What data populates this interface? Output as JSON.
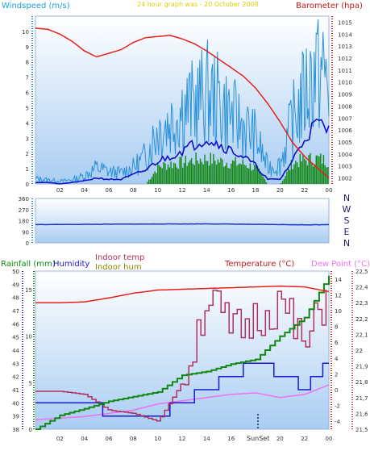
{
  "colors": {
    "plot_bg_top": "#ffffff",
    "plot_bg_bottom": "#a9cdf2",
    "windspeed_title": "#1aa0d8",
    "barometer": "#e8201a",
    "wind_gust": "#2a92d8",
    "wind_avg": "#1010cc",
    "wind_dir_bars": "#118811",
    "direction_line": "#1a2fc8",
    "rainfall": "#118811",
    "humidity": "#1a1acc",
    "indoor_temp": "#b03060",
    "indoor_hum": "#888800",
    "temperature": "#e8201a",
    "dew_point": "#f070f0",
    "axis_left_blue": "#1a7fc0",
    "axis_right_red": "#c01818"
  },
  "top": {
    "title": "24 hour graph was - 20 October 2008",
    "windspeed_label": "Windspeed (m/s)",
    "barometer_label": "Barometer (hpa)",
    "x_ticks": [
      "02",
      "04",
      "06",
      "08",
      "10",
      "12",
      "14",
      "16",
      "18",
      "20",
      "22",
      "00"
    ],
    "left_ticks": [
      "10",
      "9",
      "8",
      "7",
      "6",
      "5",
      "4",
      "3",
      "2",
      "1",
      "0"
    ],
    "right_ticks": [
      "1015",
      "1014",
      "1013",
      "1012",
      "1011",
      "1010",
      "1009",
      "1008",
      "1007",
      "1006",
      "1005",
      "1004",
      "1003",
      "1002"
    ]
  },
  "middle": {
    "left_ticks": [
      "360",
      "270",
      "180",
      "90",
      "0"
    ],
    "direction_letters": [
      "N",
      "W",
      "S",
      "E",
      "N"
    ]
  },
  "bottom": {
    "rainfall_label": "Rainfall (mm)",
    "humidity_label": "Humidity",
    "indoor_temp_label": "Indoor temp",
    "indoor_hum_label": "Indoor hum",
    "temperature_label": "Temperature (°C)",
    "dew_point_label": "Dew Point (°C)",
    "x_ticks": [
      "02",
      "04",
      "06",
      "08",
      "10",
      "12",
      "14",
      "16",
      "",
      "20",
      "22",
      "00"
    ],
    "sunset_label": "SunSet",
    "rain_ticks": [
      "15",
      "10",
      "5",
      "0"
    ],
    "humidity_ticks": [
      "50",
      "49",
      "48",
      "47",
      "46",
      "45",
      "44",
      "43",
      "42",
      "41",
      "40",
      "39",
      "38"
    ],
    "temp_ticks": [
      "14",
      "12",
      "10",
      "8",
      "6",
      "4",
      "2",
      "0",
      "-2",
      "-4"
    ],
    "indoor_ticks": [
      "22,5",
      "22,4",
      "22,3",
      "22,2",
      "22,1",
      "22",
      "21,9",
      "21,8",
      "21,7",
      "21,6",
      "21,5"
    ]
  },
  "chart_data": [
    {
      "type": "line",
      "title": "24 hour graph was - 20 October 2008",
      "x_ticks": [
        "02",
        "04",
        "06",
        "08",
        "10",
        "12",
        "14",
        "16",
        "18",
        "20",
        "22",
        "00"
      ],
      "series": [
        {
          "name": "Barometer (hpa)",
          "axis": "right",
          "ylim": [
            1001.5,
            1015.5
          ],
          "x": [
            0,
            1,
            2,
            3,
            4,
            5,
            6,
            7,
            8,
            9,
            10,
            11,
            12,
            13,
            14,
            15,
            16,
            17,
            18,
            19,
            20,
            21,
            22,
            23,
            24
          ],
          "values": [
            1014.5,
            1014.4,
            1014.0,
            1013.4,
            1012.6,
            1012.1,
            1012.4,
            1012.7,
            1013.3,
            1013.7,
            1013.8,
            1013.9,
            1013.6,
            1013.2,
            1012.6,
            1011.9,
            1011.2,
            1010.5,
            1009.5,
            1008.2,
            1006.7,
            1005.0,
            1003.8,
            1002.9,
            1002.0
          ]
        },
        {
          "name": "Windspeed gust (m/s)",
          "axis": "left",
          "ylim": [
            0,
            11
          ],
          "x": [
            0,
            1,
            2,
            3,
            4,
            5,
            6,
            7,
            8,
            9,
            10,
            11,
            12,
            13,
            14,
            15,
            16,
            17,
            18,
            19,
            20,
            21,
            22,
            23,
            24
          ],
          "values": [
            0.4,
            0.3,
            0.2,
            0.3,
            0.6,
            1.2,
            0.9,
            0.8,
            1.2,
            2.0,
            4.0,
            4.5,
            5.5,
            5.8,
            6.6,
            6.0,
            5.0,
            4.2,
            3.4,
            1.2,
            1.4,
            4.5,
            6.5,
            8.5,
            7.5
          ]
        },
        {
          "name": "Windspeed average (m/s)",
          "axis": "left",
          "ylim": [
            0,
            11
          ],
          "x": [
            0,
            1,
            2,
            3,
            4,
            5,
            6,
            7,
            8,
            9,
            10,
            11,
            12,
            13,
            14,
            15,
            16,
            17,
            18,
            19,
            20,
            21,
            22,
            23,
            24
          ],
          "values": [
            0.1,
            0.1,
            0.0,
            0.1,
            0.2,
            0.4,
            0.3,
            0.3,
            0.6,
            0.9,
            1.5,
            1.8,
            2.2,
            2.6,
            3.0,
            2.6,
            2.2,
            1.8,
            1.2,
            0.3,
            0.3,
            1.5,
            3.0,
            4.0,
            3.5
          ]
        },
        {
          "name": "Wind direction (bars)",
          "axis": "left",
          "ylim": [
            0,
            11
          ],
          "x": [
            0,
            1,
            2,
            3,
            4,
            5,
            6,
            7,
            8,
            9,
            10,
            11,
            12,
            13,
            14,
            15,
            16,
            17,
            18,
            19,
            20,
            21,
            22,
            23,
            24
          ],
          "values": [
            0,
            0,
            0,
            0,
            0,
            0,
            0,
            0,
            0,
            0,
            1.3,
            1.5,
            1.6,
            1.8,
            1.9,
            1.7,
            1.6,
            1.5,
            1.2,
            0,
            0,
            1.6,
            1.8,
            1.9,
            1.7
          ]
        }
      ]
    },
    {
      "type": "line",
      "series": [
        {
          "name": "Wind direction (°)",
          "ylim": [
            0,
            360
          ],
          "x": [
            0,
            2,
            4,
            6,
            8,
            10,
            12,
            14,
            16,
            18,
            20,
            22,
            24
          ],
          "values": [
            148,
            149,
            150,
            151,
            152,
            153,
            153,
            154,
            152,
            150,
            148,
            146,
            148
          ]
        }
      ]
    },
    {
      "type": "line",
      "x_ticks": [
        "02",
        "04",
        "06",
        "08",
        "10",
        "12",
        "14",
        "16",
        "",
        "20",
        "22",
        "00"
      ],
      "series": [
        {
          "name": "Temperature (°C)",
          "axis": "right",
          "ylim": [
            -5,
            15
          ],
          "x": [
            0,
            2,
            4,
            6,
            8,
            10,
            12,
            14,
            16,
            18,
            20,
            22,
            24
          ],
          "values": [
            11.0,
            11.0,
            11.1,
            11.6,
            12.2,
            12.6,
            12.7,
            12.8,
            12.9,
            13.0,
            13.1,
            13.0,
            12.4
          ]
        },
        {
          "name": "Dew Point (°C)",
          "axis": "right",
          "ylim": [
            -5,
            15
          ],
          "x": [
            0,
            2,
            4,
            6,
            8,
            10,
            12,
            14,
            16,
            18,
            20,
            22,
            24
          ],
          "values": [
            -3.8,
            -3.6,
            -3.4,
            -3.0,
            -2.6,
            -1.8,
            -1.4,
            -1.0,
            -0.6,
            -0.4,
            -1.0,
            -0.6,
            0.6
          ]
        },
        {
          "name": "Rainfall (mm)",
          "axis": "left",
          "ylim": [
            0,
            17
          ],
          "x": [
            0,
            2,
            4,
            6,
            8,
            10,
            12,
            14,
            16,
            18,
            20,
            22,
            24
          ],
          "values": [
            0.0,
            1.5,
            2.2,
            3.0,
            3.5,
            4.0,
            5.8,
            6.2,
            7.0,
            7.5,
            10.0,
            12.0,
            16.5
          ]
        },
        {
          "name": "Humidity",
          "axis": "left",
          "ylim": [
            38,
            50
          ],
          "x": [
            0,
            2,
            4,
            6,
            8,
            10,
            12,
            14,
            16,
            18,
            20,
            22,
            24
          ],
          "values": [
            40.0,
            40.0,
            40.0,
            39.0,
            39.0,
            39.0,
            40.0,
            41.0,
            42.0,
            43.0,
            42.0,
            41.0,
            43.0
          ]
        },
        {
          "name": "Indoor temp",
          "axis": "right-inner",
          "ylim": [
            21.5,
            22.5
          ],
          "x": [
            0,
            2,
            4,
            6,
            8,
            10,
            12,
            14,
            16,
            18,
            20,
            22,
            24
          ],
          "values": [
            21.74,
            21.74,
            21.72,
            21.62,
            21.6,
            21.55,
            21.8,
            22.35,
            22.1,
            22.2,
            22.3,
            22.0,
            22.4
          ]
        },
        {
          "name": "Indoor hum",
          "axis": "left",
          "ylim": [
            38,
            50
          ],
          "x": [
            0,
            24
          ],
          "values": [
            null,
            null
          ]
        }
      ]
    }
  ]
}
